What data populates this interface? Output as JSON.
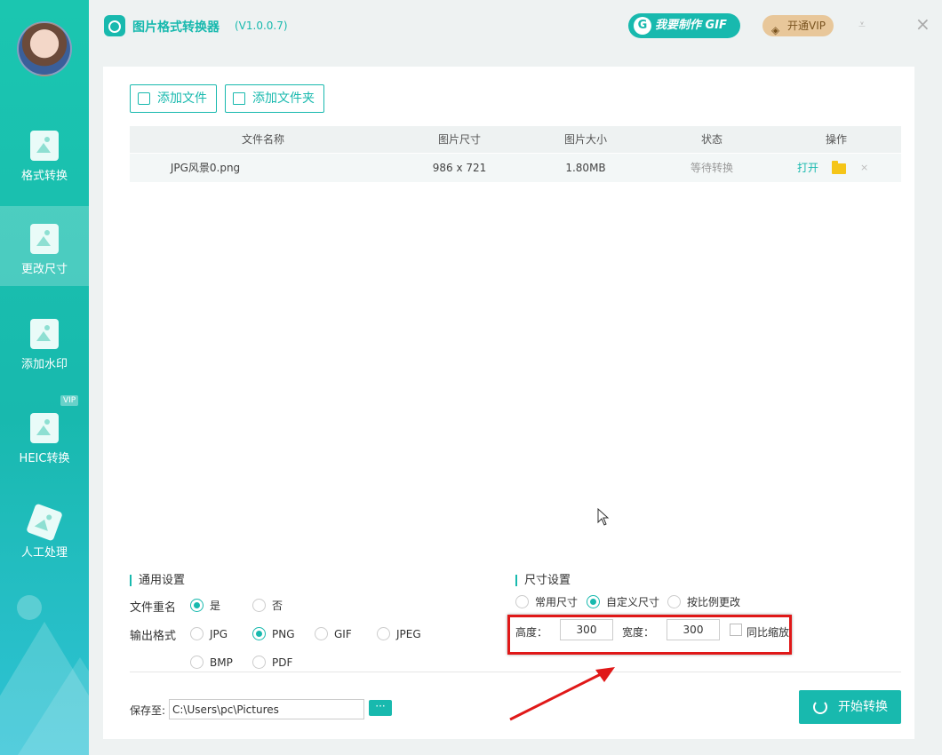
{
  "app": {
    "title": "图片格式转换器",
    "version": "(V1.0.0.7)"
  },
  "header": {
    "gif_button": "我要制作 GIF",
    "gif_icon": "G",
    "vip_button": "开通VIP"
  },
  "sidebar": {
    "items": [
      {
        "label": "格式转换",
        "icon": "image-convert-icon"
      },
      {
        "label": "更改尺寸",
        "icon": "image-resize-icon",
        "active": true
      },
      {
        "label": "添加水印",
        "icon": "image-watermark-icon"
      },
      {
        "label": "HEIC转换",
        "icon": "heic-icon",
        "tag": "VIP"
      },
      {
        "label": "人工处理",
        "icon": "manual-process-icon"
      }
    ]
  },
  "toolbar": {
    "add_file": "添加文件",
    "add_folder": "添加文件夹"
  },
  "table": {
    "headers": [
      "文件名称",
      "图片尺寸",
      "图片大小",
      "状态",
      "操作"
    ],
    "rows": [
      {
        "name": "JPG风景0.png",
        "dimensions": "986 x 721",
        "size": "1.80MB",
        "status": "等待转换",
        "open": "打开",
        "delete": "×"
      }
    ]
  },
  "general_settings": {
    "title": "通用设置",
    "rename_label": "文件重名",
    "rename_yes": "是",
    "rename_no": "否",
    "rename_selected": "是",
    "format_label": "输出格式",
    "formats": [
      "JPG",
      "PNG",
      "GIF",
      "JPEG",
      "BMP",
      "PDF"
    ],
    "format_selected": "PNG"
  },
  "size_settings": {
    "title": "尺寸设置",
    "options": [
      "常用尺寸",
      "自定义尺寸",
      "按比例更改"
    ],
    "selected": "自定义尺寸",
    "height_label": "高度：",
    "height_value": "300",
    "width_label": "宽度：",
    "width_value": "300",
    "keep_ratio_label": "同比缩放",
    "keep_ratio_checked": false
  },
  "footer": {
    "save_label": "保存至:",
    "save_path": "C:\\Users\\pc\\Pictures",
    "browse_label": "···",
    "start_button": "开始转换"
  },
  "colors": {
    "accent": "#18b9ae",
    "highlight": "#e01818"
  }
}
